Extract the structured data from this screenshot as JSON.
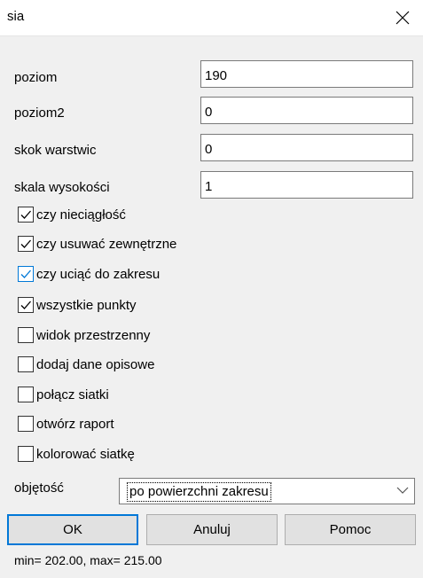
{
  "window": {
    "title": "sia"
  },
  "fields": [
    {
      "label": "poziom",
      "value": "190"
    },
    {
      "label": "poziom2",
      "value": "0"
    },
    {
      "label": "skok warstwic",
      "value": "0"
    },
    {
      "label": "skala wysokości",
      "value": "1"
    }
  ],
  "checkboxes": [
    {
      "label": "czy nieciągłość",
      "checked": true
    },
    {
      "label": "czy usuwać zewnętrzne",
      "checked": true
    },
    {
      "label": "czy uciąć do zakresu",
      "checked": true
    },
    {
      "label": "wszystkie punkty",
      "checked": true
    },
    {
      "label": "widok przestrzenny",
      "checked": false
    },
    {
      "label": "dodaj dane opisowe",
      "checked": false
    },
    {
      "label": "połącz siatki",
      "checked": false
    },
    {
      "label": "otwórz raport",
      "checked": false
    },
    {
      "label": "kolorować siatkę",
      "checked": false
    }
  ],
  "volume": {
    "label": "objętość",
    "selected": "po powierzchni zakresu"
  },
  "buttons": {
    "ok": "OK",
    "cancel": "Anuluj",
    "help": "Pomoc"
  },
  "status": "min= 202.00, max= 215.00",
  "colors": {
    "accent": "#0078d7",
    "background": "#f0f0f0",
    "button_face": "#e1e1e1"
  }
}
